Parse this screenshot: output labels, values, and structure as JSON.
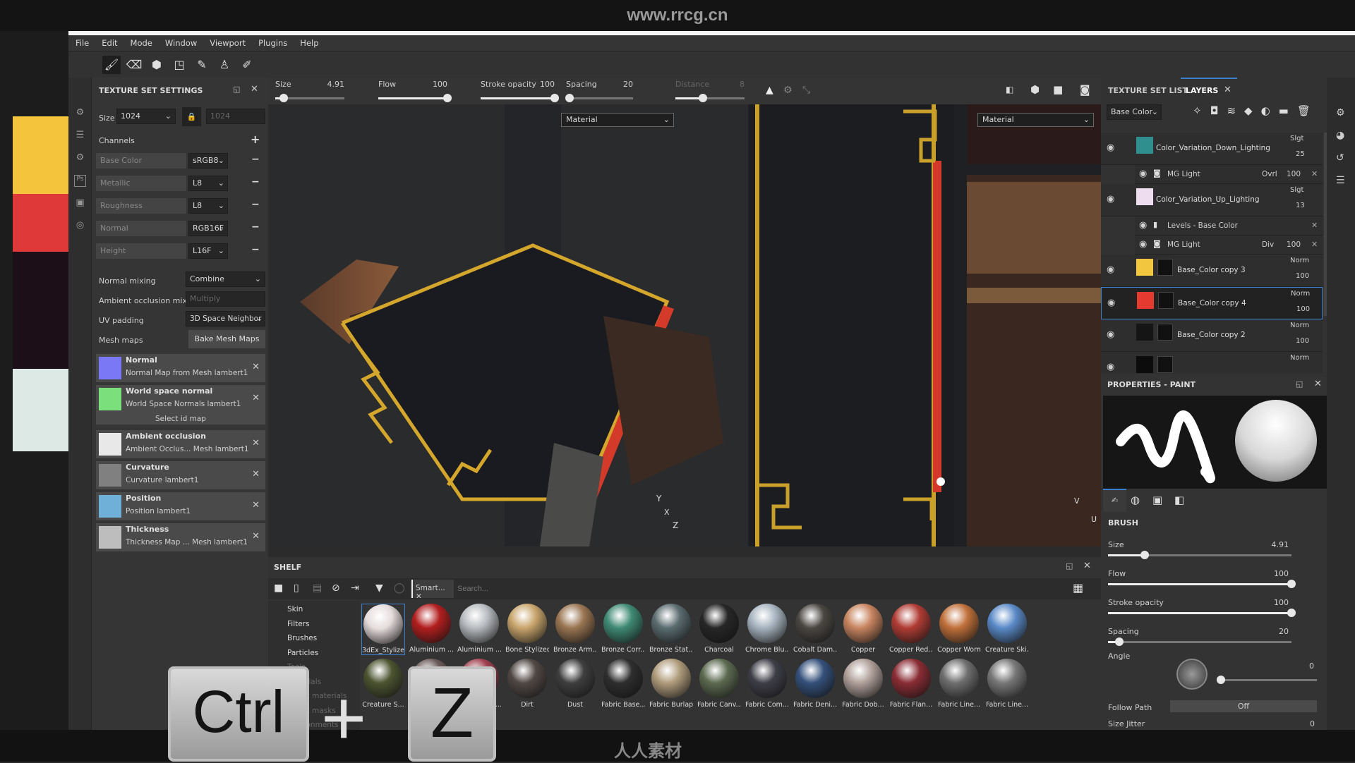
{
  "watermark": {
    "top": "www.rrcg.cn",
    "bottom": "人人素材"
  },
  "colors": {
    "accent": "#3b7fd1",
    "swatches": [
      "#f4c43c",
      "#e0393a",
      "#1d0f18",
      "#dde9e4"
    ]
  },
  "menu": [
    "File",
    "Edit",
    "Mode",
    "Window",
    "Viewport",
    "Plugins",
    "Help"
  ],
  "tools": [
    {
      "icon": "brush-icon",
      "glyph": "🖌"
    },
    {
      "icon": "eraser-icon",
      "glyph": "⌫"
    },
    {
      "icon": "projection-icon",
      "glyph": "⬢"
    },
    {
      "icon": "polygon-fill-icon",
      "glyph": "◳"
    },
    {
      "icon": "smudge-icon",
      "glyph": "✎"
    },
    {
      "icon": "clone-stamp-icon",
      "glyph": "♙"
    },
    {
      "icon": "color-picker-icon",
      "glyph": "✐"
    }
  ],
  "texture_set_settings": {
    "title": "TEXTURE SET SETTINGS",
    "size_label": "Size",
    "size_value": "1024",
    "size_locked_value": "1024",
    "channels_label": "Channels",
    "channels": [
      {
        "name": "Base Color",
        "format": "sRGB8"
      },
      {
        "name": "Metallic",
        "format": "L8"
      },
      {
        "name": "Roughness",
        "format": "L8"
      },
      {
        "name": "Normal",
        "format": "RGB16F"
      },
      {
        "name": "Height",
        "format": "L16F"
      }
    ],
    "normal_mixing_label": "Normal mixing",
    "normal_mixing": "Combine",
    "ao_mixing_label": "Ambient occlusion mixing",
    "ao_mixing": "Multiply",
    "uv_padding_label": "UV padding",
    "uv_padding": "3D Space Neighbor",
    "mesh_maps_label": "Mesh maps",
    "bake_button": "Bake Mesh Maps",
    "select_id_map": "Select id map",
    "mesh_maps": [
      {
        "name": "Normal",
        "source": "Normal Map from Mesh lambert1",
        "color": "#7b78f5"
      },
      {
        "name": "World space normal",
        "source": "World Space Normals lambert1",
        "color": "#7be07b"
      },
      {
        "name": "Ambient occlusion",
        "source": "Ambient Occlus... Mesh lambert1",
        "color": "#e8e8e8"
      },
      {
        "name": "Curvature",
        "source": "Curvature lambert1",
        "color": "#808080"
      },
      {
        "name": "Position",
        "source": "Position lambert1",
        "color": "#6fb0d8"
      },
      {
        "name": "Thickness",
        "source": "Thickness Map ... Mesh lambert1",
        "color": "#bdbdbd"
      }
    ]
  },
  "context_bar": {
    "size_label": "Size",
    "size": "4.91",
    "size_pct": 0.12,
    "flow_label": "Flow",
    "flow": "100",
    "flow_pct": 1,
    "opacity_label": "Stroke opacity",
    "opacity": "100",
    "opacity_pct": 1,
    "spacing_label": "Spacing",
    "spacing": "20",
    "spacing_pct": 0.05,
    "distance_label": "Distance",
    "distance": "8",
    "distance_pct": 0.4
  },
  "viewport": {
    "material_3d": "Material",
    "material_2d": "Material",
    "axis_y": "Y",
    "axis_x": "X",
    "axis_z": "Z",
    "uv_axis_v": "V",
    "uv_axis_u": "U"
  },
  "shelf": {
    "title": "SHELF",
    "tab": "Smart...",
    "search_placeholder": "Search...",
    "categories": [
      "Skin",
      "Filters",
      "Brushes",
      "Particles",
      "Tools",
      "Materials",
      "Smart materials",
      "Smart masks",
      "Environments"
    ],
    "materials_row1": [
      {
        "name": "3dEx_Stylize...",
        "color": "#e6dcdc"
      },
      {
        "name": "Aluminium ...",
        "color": "#b21e1e"
      },
      {
        "name": "Aluminium ...",
        "color": "#b8bcc0"
      },
      {
        "name": "Bone Stylized",
        "color": "#c9a56c"
      },
      {
        "name": "Bronze Arm...",
        "color": "#9a7552"
      },
      {
        "name": "Bronze Corr...",
        "color": "#3f8a74"
      },
      {
        "name": "Bronze Stat...",
        "color": "#5b6c70"
      },
      {
        "name": "Charcoal",
        "color": "#262626"
      },
      {
        "name": "Chrome Blu...",
        "color": "#a7b4c0"
      },
      {
        "name": "Cobalt Dam...",
        "color": "#4a4642"
      },
      {
        "name": "Copper",
        "color": "#c88560"
      },
      {
        "name": "Copper Red...",
        "color": "#b03c34"
      },
      {
        "name": "Copper Worn",
        "color": "#c0703a"
      },
      {
        "name": "Creature Ski...",
        "color": "#5a8ac8"
      }
    ],
    "materials_row2": [
      {
        "name": "Creature S...",
        "color": "#4c5430"
      },
      {
        "name": "",
        "color": "#6a5a5a"
      },
      {
        "name": "Creature To...",
        "color": "#a04050"
      },
      {
        "name": "Dirt",
        "color": "#504845"
      },
      {
        "name": "Dust",
        "color": "#3e3e3e"
      },
      {
        "name": "Fabric Base...",
        "color": "#2e2e2e"
      },
      {
        "name": "Fabric Burlap",
        "color": "#b09c7c"
      },
      {
        "name": "Fabric Canv...",
        "color": "#5c6a50"
      },
      {
        "name": "Fabric Com...",
        "color": "#3e3e48"
      },
      {
        "name": "Fabric Deni...",
        "color": "#34507a"
      },
      {
        "name": "Fabric Dob...",
        "color": "#b0a09a"
      },
      {
        "name": "Fabric Flan...",
        "color": "#8a2c34"
      },
      {
        "name": "Fabric Line...",
        "color": "#6e6e6e"
      },
      {
        "name": "Fabric Line...",
        "color": "#777777"
      }
    ]
  },
  "layers_panel": {
    "tab_texture_set_list": "TEXTURE SET LIST",
    "tab_layers": "LAYERS",
    "channel": "Base Color",
    "layers": [
      {
        "name": "Color_Variation_Down_Lighting",
        "blend": "Slgt",
        "opacity": "25",
        "thumb": "#2f8f8f",
        "kind": "folder"
      },
      {
        "name": "MG Light",
        "blend": "Ovrl",
        "opacity": "100",
        "kind": "effect"
      },
      {
        "name": "Color_Variation_Up_Lighting",
        "blend": "Slgt",
        "opacity": "13",
        "thumb": "#eedcef",
        "kind": "folder"
      },
      {
        "name": "Levels - Base Color",
        "blend": "",
        "opacity": "",
        "kind": "effect"
      },
      {
        "name": "MG Light",
        "blend": "Div",
        "opacity": "100",
        "kind": "effect"
      },
      {
        "name": "Base_Color copy 3",
        "blend": "Norm",
        "opacity": "100",
        "thumb": "#f2c63e",
        "kind": "fill"
      },
      {
        "name": "Base_Color copy 4",
        "blend": "Norm",
        "opacity": "100",
        "thumb": "#e53a30",
        "kind": "fill",
        "selected": true
      },
      {
        "name": "Base_Color copy 2",
        "blend": "Norm",
        "opacity": "100",
        "thumb": "#151515",
        "kind": "fill"
      },
      {
        "name": "",
        "blend": "Norm",
        "opacity": "",
        "thumb": "#0c0c0c",
        "kind": "fill"
      }
    ]
  },
  "properties": {
    "title": "PROPERTIES - PAINT",
    "brush_heading": "BRUSH",
    "sliders": [
      {
        "label": "Size",
        "value": "4.91",
        "pct": 0.2
      },
      {
        "label": "Flow",
        "value": "100",
        "pct": 1
      },
      {
        "label": "Stroke opacity",
        "value": "100",
        "pct": 1
      },
      {
        "label": "Spacing",
        "value": "20",
        "pct": 0.06
      }
    ],
    "angle_label": "Angle",
    "angle": "0",
    "follow_path_label": "Follow Path",
    "follow_path": "Off",
    "size_jitter_label": "Size Jitter",
    "size_jitter": "0"
  },
  "overlay_keys": {
    "key1": "Ctrl",
    "plus": "+",
    "key2": "Z"
  }
}
